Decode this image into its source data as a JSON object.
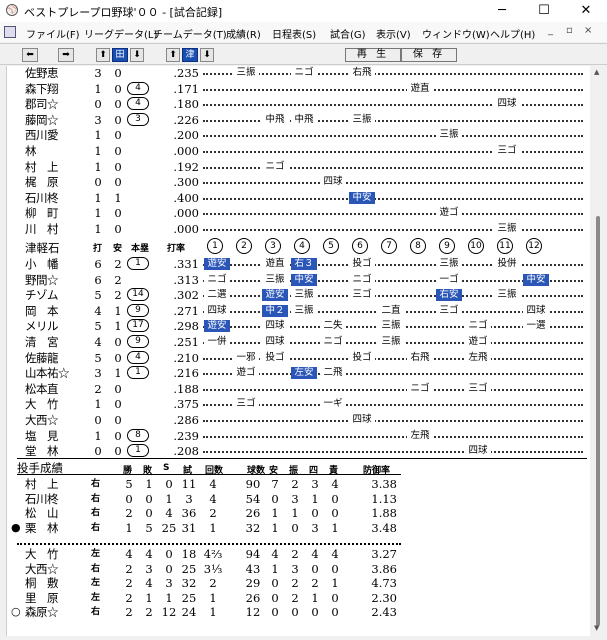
{
  "window": {
    "title": "ベストプレープロ野球'００ - [試合記録]",
    "controls": {
      "minimize": "─",
      "maximize": "☐",
      "close": "✕"
    }
  },
  "menu": {
    "items": [
      "ファイル(F)",
      "リーグデータ(L)",
      "チームデータ(T)",
      "成績(R)",
      "日程表(S)",
      "試合(G)",
      "表示(V)",
      "ウィンドウ(W)",
      "ヘルプ(H)"
    ],
    "mdi_controls": [
      "_",
      "▫",
      "×"
    ]
  },
  "toolbar": {
    "left_label": "田",
    "right_label": "津",
    "replay_label": "再 生",
    "save_label": "保 存"
  },
  "top_batters": [
    {
      "name": "佐野恵",
      "ab": "3",
      "h": "0",
      "hr": "",
      "avg": ".235",
      "results": [
        [
          "三振",
          1
        ],
        [
          "ニゴ",
          3
        ],
        [
          "右飛",
          5
        ]
      ]
    },
    {
      "name": "森下翔",
      "ab": "1",
      "h": "0",
      "hr": "4",
      "avg": ".171",
      "results": [
        [
          "遊直",
          7
        ]
      ]
    },
    {
      "name": "郡司☆",
      "ab": "0",
      "h": "0",
      "hr": "4",
      "avg": ".180",
      "results": [
        [
          "四球",
          10
        ]
      ]
    },
    {
      "name": "藤岡☆",
      "ab": "3",
      "h": "0",
      "hr": "3",
      "avg": ".226",
      "results": [
        [
          "中飛",
          2
        ],
        [
          "中飛",
          3
        ],
        [
          "三振",
          5
        ]
      ]
    },
    {
      "name": "西川愛",
      "ab": "1",
      "h": "0",
      "hr": "",
      "avg": ".200",
      "results": [
        [
          "三振",
          8
        ]
      ]
    },
    {
      "name": "林",
      "ab": "1",
      "h": "0",
      "hr": "",
      "avg": ".000",
      "results": [
        [
          "三ゴ",
          10
        ]
      ]
    },
    {
      "name": "村　上",
      "ab": "1",
      "h": "0",
      "hr": "",
      "avg": ".192",
      "results": [
        [
          "ニゴ",
          2
        ]
      ]
    },
    {
      "name": "梶　原",
      "ab": "0",
      "h": "0",
      "hr": "",
      "avg": ".300",
      "results": [
        [
          "四球",
          4
        ]
      ]
    },
    {
      "name": "石川柊",
      "ab": "1",
      "h": "1",
      "hr": "",
      "avg": ".400",
      "results": [
        [
          "中安",
          5,
          true
        ]
      ]
    },
    {
      "name": "柳　町",
      "ab": "1",
      "h": "0",
      "hr": "",
      "avg": ".000",
      "results": [
        [
          "遊ゴ",
          8
        ]
      ]
    },
    {
      "name": "川　村",
      "ab": "1",
      "h": "0",
      "hr": "",
      "avg": ".000",
      "results": [
        [
          "三振",
          10
        ]
      ]
    }
  ],
  "team2": {
    "name": "津軽石",
    "col_ab": "打",
    "col_h": "安",
    "col_hr": "本塁",
    "col_avg": "打率",
    "innings": [
      "1",
      "2",
      "3",
      "4",
      "5",
      "6",
      "7",
      "8",
      "9",
      "10",
      "11",
      "12"
    ]
  },
  "bottom_batters": [
    {
      "name": "小　幡",
      "ab": "6",
      "h": "2",
      "hr": "1",
      "avg": ".331",
      "results": [
        [
          "遊安",
          0,
          true
        ],
        [
          "遊直",
          2
        ],
        [
          "右３",
          3,
          true
        ],
        [
          "投ゴ",
          5
        ],
        [
          "三振",
          8
        ],
        [
          "投併",
          10
        ]
      ]
    },
    {
      "name": "野間☆",
      "ab": "6",
      "h": "2",
      "hr": "",
      "avg": ".313",
      "results": [
        [
          "ニゴ",
          0
        ],
        [
          "三振",
          2
        ],
        [
          "中安",
          3,
          true
        ],
        [
          "ニゴ",
          5
        ],
        [
          "一ゴ",
          8
        ],
        [
          "中安",
          11,
          true
        ]
      ]
    },
    {
      "name": "チゾム",
      "ab": "5",
      "h": "2",
      "hr": "14",
      "avg": ".302",
      "results": [
        [
          "二選",
          0
        ],
        [
          "遊安",
          2,
          true
        ],
        [
          "三振",
          3
        ],
        [
          "三ゴ",
          5
        ],
        [
          "右安",
          8,
          true
        ],
        [
          "三振",
          10
        ]
      ]
    },
    {
      "name": "岡　本",
      "ab": "4",
      "h": "1",
      "hr": "9",
      "avg": ".271",
      "results": [
        [
          "四球",
          0
        ],
        [
          "中２",
          2,
          true
        ],
        [
          "三振",
          3
        ],
        [
          "二直",
          6
        ],
        [
          "三ゴ",
          8
        ],
        [
          "四球",
          11
        ]
      ]
    },
    {
      "name": "メリル",
      "ab": "5",
      "h": "1",
      "hr": "17",
      "avg": ".298",
      "results": [
        [
          "遊安",
          0,
          true
        ],
        [
          "四球",
          2
        ],
        [
          "二失",
          4
        ],
        [
          "三振",
          6
        ],
        [
          "ニゴ",
          9
        ],
        [
          "一選",
          11
        ]
      ]
    },
    {
      "name": "清　宮",
      "ab": "4",
      "h": "0",
      "hr": "9",
      "avg": ".251",
      "results": [
        [
          "一併",
          0
        ],
        [
          "四球",
          2
        ],
        [
          "ニゴ",
          4
        ],
        [
          "三振",
          6
        ],
        [
          "遊ゴ",
          9
        ]
      ]
    },
    {
      "name": "佐藤龍",
      "ab": "5",
      "h": "0",
      "hr": "4",
      "avg": ".210",
      "results": [
        [
          "一邪",
          1
        ],
        [
          "投ゴ",
          2
        ],
        [
          "投ゴ",
          5
        ],
        [
          "右飛",
          7
        ],
        [
          "左飛",
          9
        ]
      ]
    },
    {
      "name": "山本祐☆",
      "ab": "3",
      "h": "1",
      "hr": "1",
      "avg": ".216",
      "results": [
        [
          "遊ゴ",
          1
        ],
        [
          "左安",
          3,
          true
        ],
        [
          "二飛",
          4
        ]
      ]
    },
    {
      "name": "松本直",
      "ab": "2",
      "h": "0",
      "hr": "",
      "avg": ".188",
      "results": [
        [
          "ニゴ",
          7
        ],
        [
          "三ゴ",
          9
        ]
      ]
    },
    {
      "name": "大　竹",
      "ab": "1",
      "h": "0",
      "hr": "",
      "avg": ".375",
      "results": [
        [
          "三ゴ",
          1
        ],
        [
          "一ギ",
          4
        ]
      ]
    },
    {
      "name": "大西☆",
      "ab": "0",
      "h": "0",
      "hr": "",
      "avg": ".286",
      "results": [
        [
          "四球",
          5
        ]
      ]
    },
    {
      "name": "塩　見",
      "ab": "1",
      "h": "0",
      "hr": "8",
      "avg": ".239",
      "results": [
        [
          "左飛",
          7
        ]
      ]
    },
    {
      "name": "堂　林",
      "ab": "0",
      "h": "0",
      "hr": "1",
      "avg": ".208",
      "results": [
        [
          "四球",
          9
        ]
      ]
    }
  ],
  "pitching": {
    "title": "投手成績",
    "cols": [
      "勝",
      "敗",
      "S",
      "試",
      "回数",
      "球数",
      "安",
      "振",
      "四",
      "責",
      "防御率"
    ],
    "group1": [
      {
        "mark": "",
        "name": "村　上",
        "hand": "右",
        "w": "5",
        "l": "1",
        "s": "0",
        "g": "11",
        "ip": "4",
        "pitches": "90",
        "h": "7",
        "so": "2",
        "bb": "3",
        "er": "4",
        "era": "3.38"
      },
      {
        "mark": "",
        "name": "石川柊",
        "hand": "右",
        "w": "0",
        "l": "0",
        "s": "1",
        "g": "3",
        "ip": "4",
        "pitches": "54",
        "h": "0",
        "so": "3",
        "bb": "1",
        "er": "0",
        "era": "1.13"
      },
      {
        "mark": "",
        "name": "松　山",
        "hand": "右",
        "w": "2",
        "l": "0",
        "s": "4",
        "g": "36",
        "ip": "2",
        "pitches": "26",
        "h": "1",
        "so": "1",
        "bb": "0",
        "er": "0",
        "era": "1.88"
      },
      {
        "mark": "●",
        "name": "栗　林",
        "hand": "右",
        "w": "1",
        "l": "5",
        "s": "25",
        "g": "31",
        "ip": "1",
        "pitches": "32",
        "h": "1",
        "so": "0",
        "bb": "3",
        "er": "1",
        "era": "3.48"
      }
    ],
    "group2": [
      {
        "mark": "",
        "name": "大　竹",
        "hand": "左",
        "w": "4",
        "l": "4",
        "s": "0",
        "g": "18",
        "ip": "4⅔",
        "pitches": "94",
        "h": "4",
        "so": "2",
        "bb": "4",
        "er": "4",
        "era": "3.27"
      },
      {
        "mark": "",
        "name": "大西☆",
        "hand": "右",
        "w": "2",
        "l": "3",
        "s": "0",
        "g": "25",
        "ip": "3⅓",
        "pitches": "43",
        "h": "1",
        "so": "3",
        "bb": "0",
        "er": "0",
        "era": "3.86"
      },
      {
        "mark": "",
        "name": "桐　敷",
        "hand": "左",
        "w": "2",
        "l": "4",
        "s": "3",
        "g": "32",
        "ip": "2",
        "pitches": "29",
        "h": "0",
        "so": "2",
        "bb": "2",
        "er": "1",
        "era": "4.73"
      },
      {
        "mark": "",
        "name": "里　原",
        "hand": "左",
        "w": "2",
        "l": "1",
        "s": "1",
        "g": "25",
        "ip": "1",
        "pitches": "26",
        "h": "0",
        "so": "2",
        "bb": "1",
        "er": "0",
        "era": "2.30"
      },
      {
        "mark": "○",
        "name": "森原☆",
        "hand": "右",
        "w": "2",
        "l": "2",
        "s": "12",
        "g": "24",
        "ip": "1",
        "pitches": "12",
        "h": "0",
        "so": "0",
        "bb": "0",
        "er": "0",
        "era": "2.43"
      }
    ]
  }
}
